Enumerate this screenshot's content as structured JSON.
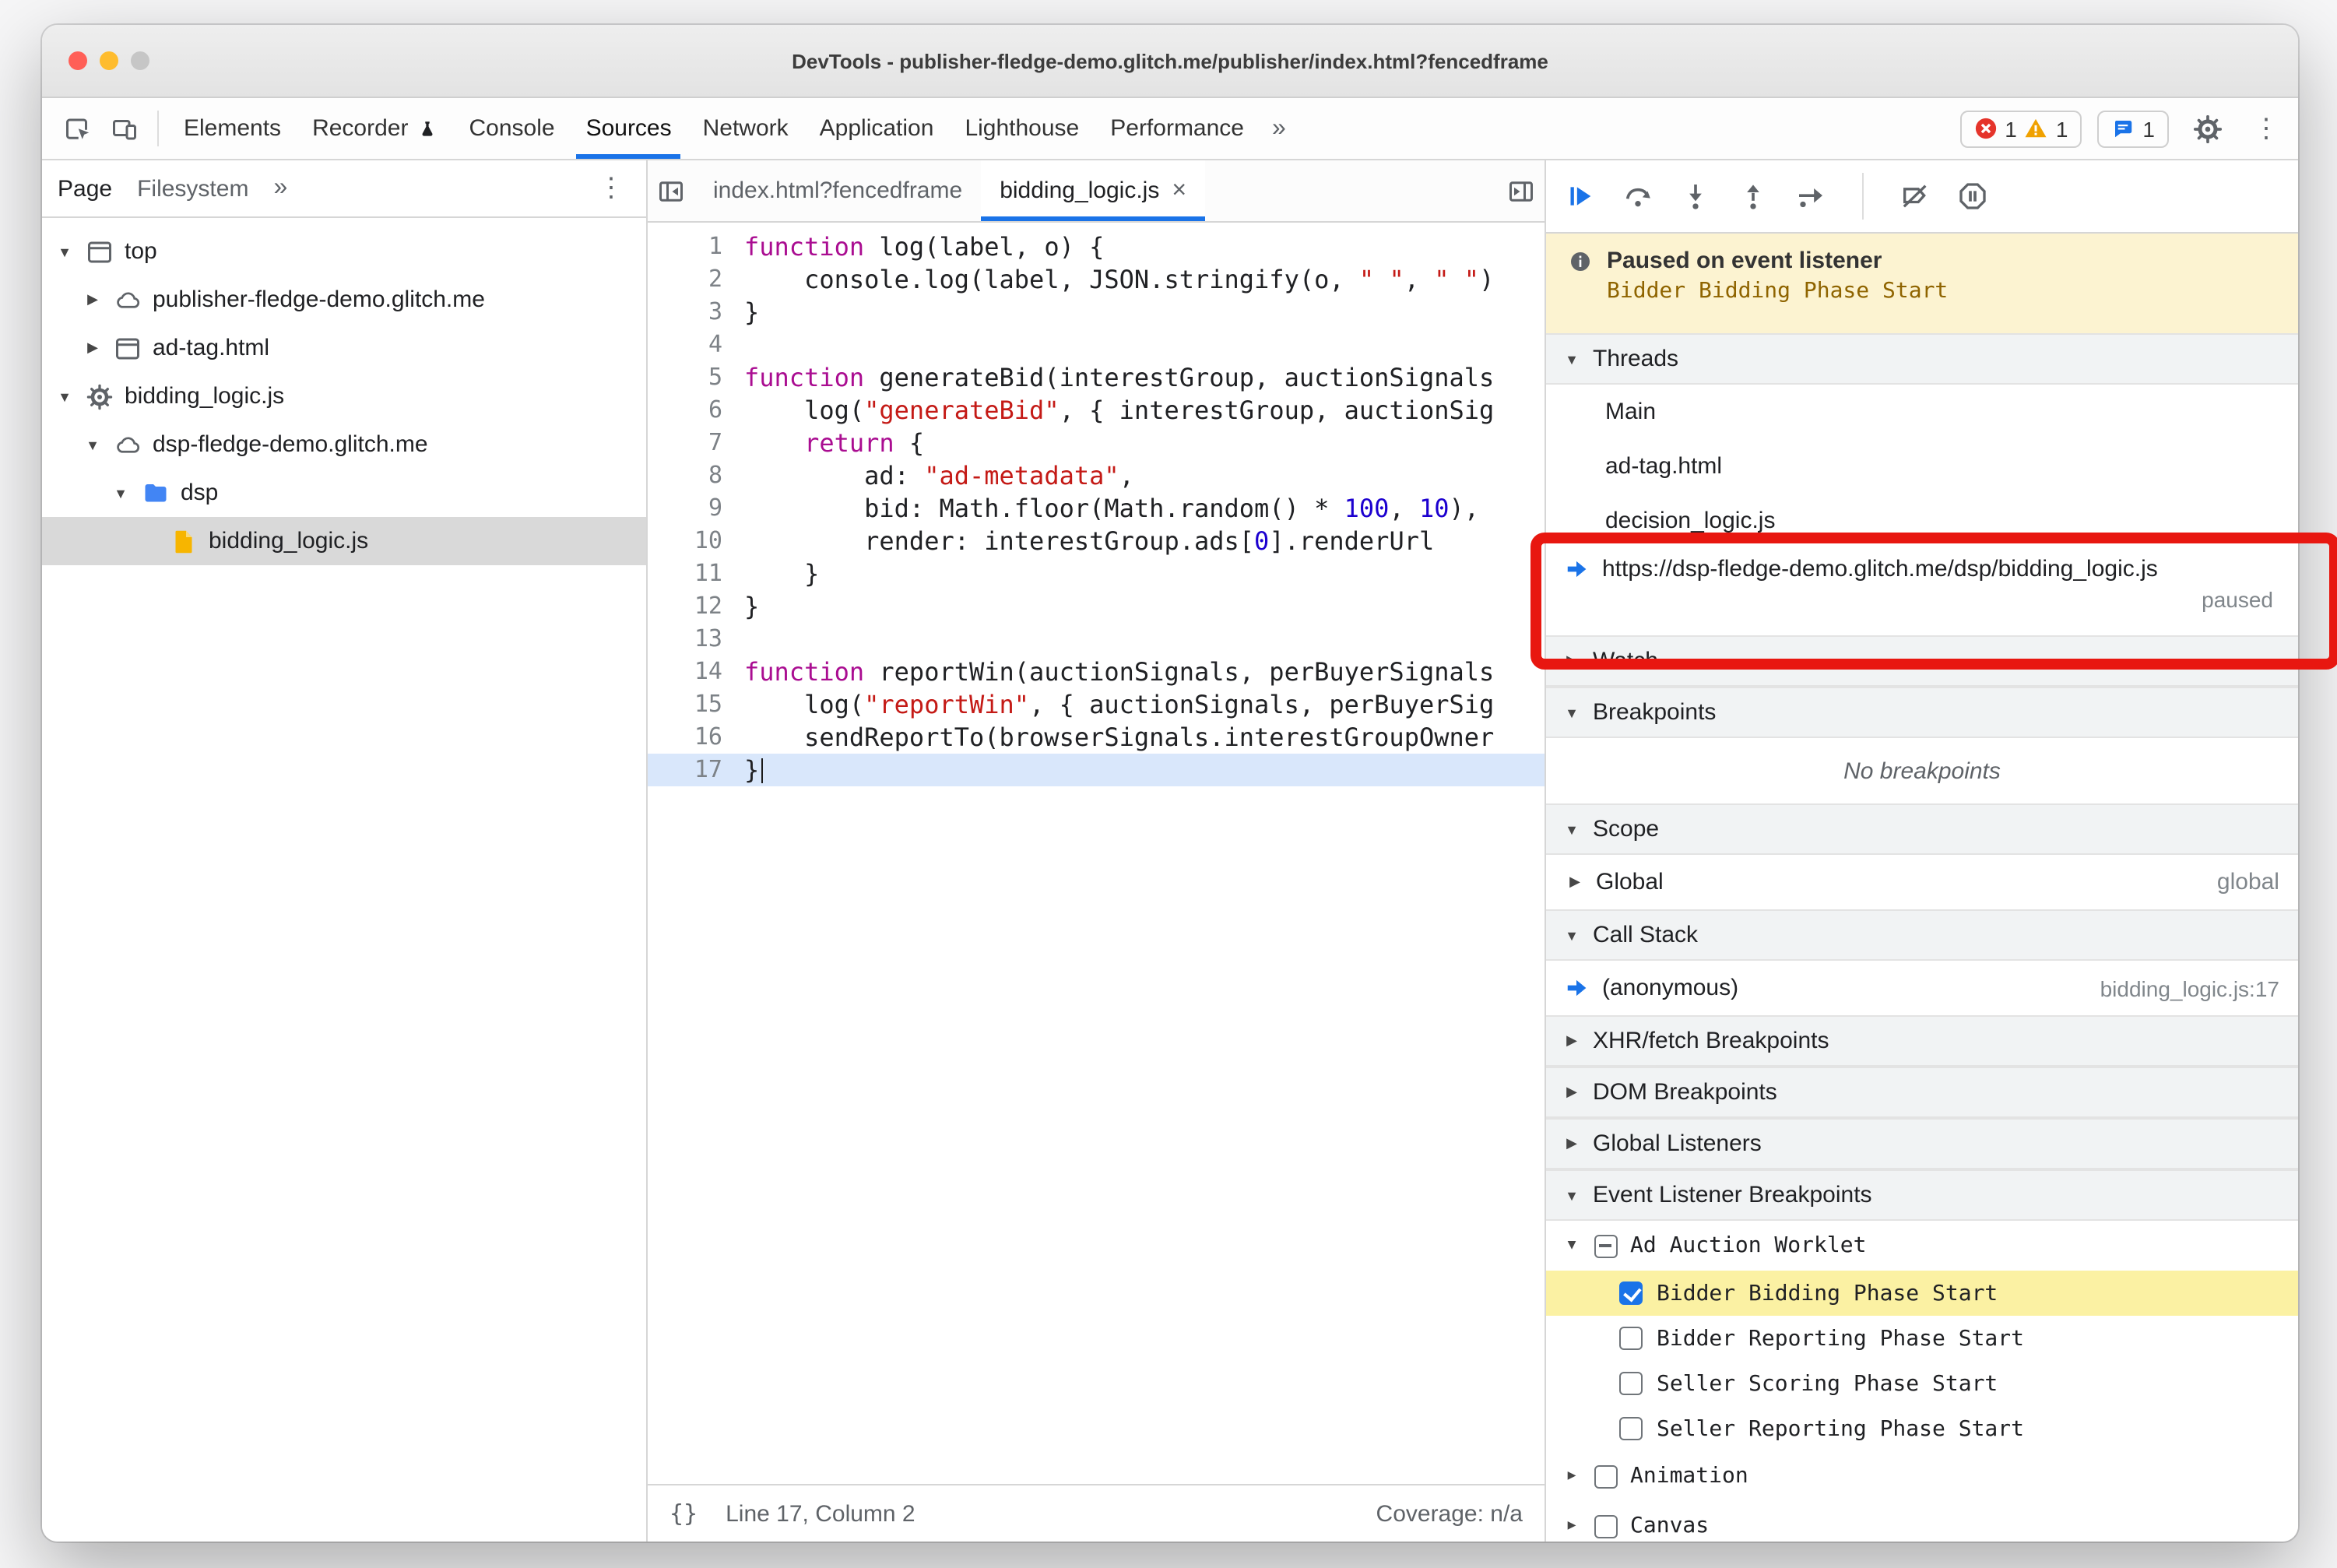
{
  "titlebar": {
    "title": "DevTools - publisher-fledge-demo.glitch.me/publisher/index.html?fencedframe"
  },
  "main_toolbar": {
    "tabs": [
      {
        "label": "Elements"
      },
      {
        "label": "Recorder",
        "badge": "flask"
      },
      {
        "label": "Console"
      },
      {
        "label": "Sources",
        "active": true
      },
      {
        "label": "Network"
      },
      {
        "label": "Application"
      },
      {
        "label": "Lighthouse"
      },
      {
        "label": "Performance"
      }
    ],
    "more": "»",
    "error_count": "1",
    "warning_count": "1",
    "issue_count": "1",
    "kebab": "⋮"
  },
  "sidebar": {
    "tabs": [
      {
        "label": "Page",
        "active": true
      },
      {
        "label": "Filesystem"
      }
    ],
    "more": "»",
    "kebab": "⋮",
    "tree": [
      {
        "label": "top",
        "icon": "frame",
        "arrow": "down",
        "indent": 0
      },
      {
        "label": "publisher-fledge-demo.glitch.me",
        "icon": "cloud",
        "arrow": "right",
        "indent": 1
      },
      {
        "label": "ad-tag.html",
        "icon": "frame",
        "arrow": "right",
        "indent": 1
      },
      {
        "label": "bidding_logic.js",
        "icon": "gear",
        "arrow": "down",
        "indent": 0
      },
      {
        "label": "dsp-fledge-demo.glitch.me",
        "icon": "cloud",
        "arrow": "down",
        "indent": 1
      },
      {
        "label": "dsp",
        "icon": "folder",
        "arrow": "down",
        "indent": 2
      },
      {
        "label": "bidding_logic.js",
        "icon": "file",
        "arrow": "none",
        "indent": 3,
        "selected": true
      }
    ]
  },
  "editor": {
    "tabs": [
      {
        "label": "index.html?fencedframe"
      },
      {
        "label": "bidding_logic.js",
        "active": true,
        "closable": true
      }
    ],
    "close_glyph": "×",
    "cursor_line": 17,
    "code": [
      [
        {
          "t": "function",
          "c": "k"
        },
        {
          "t": " log(label, o) {",
          "c": "p"
        }
      ],
      [
        {
          "t": "    console.log(label, JSON.stringify(o, ",
          "c": "p"
        },
        {
          "t": "\" \"",
          "c": "s"
        },
        {
          "t": ", ",
          "c": "p"
        },
        {
          "t": "\" \"",
          "c": "s"
        },
        {
          "t": ")",
          "c": "p"
        }
      ],
      [
        {
          "t": "}",
          "c": "p"
        }
      ],
      [],
      [
        {
          "t": "function",
          "c": "k"
        },
        {
          "t": " generateBid(interestGroup, auctionSignals",
          "c": "p"
        }
      ],
      [
        {
          "t": "    log(",
          "c": "p"
        },
        {
          "t": "\"generateBid\"",
          "c": "s"
        },
        {
          "t": ", { interestGroup, auctionSig",
          "c": "p"
        }
      ],
      [
        {
          "t": "    ",
          "c": "p"
        },
        {
          "t": "return",
          "c": "k"
        },
        {
          "t": " {",
          "c": "p"
        }
      ],
      [
        {
          "t": "        ad: ",
          "c": "p"
        },
        {
          "t": "\"ad-metadata\"",
          "c": "s"
        },
        {
          "t": ",",
          "c": "p"
        }
      ],
      [
        {
          "t": "        bid: Math.floor(Math.random() * ",
          "c": "p"
        },
        {
          "t": "100",
          "c": "n"
        },
        {
          "t": ", ",
          "c": "p"
        },
        {
          "t": "10",
          "c": "n"
        },
        {
          "t": "),",
          "c": "p"
        }
      ],
      [
        {
          "t": "        render: interestGroup.ads[",
          "c": "p"
        },
        {
          "t": "0",
          "c": "n"
        },
        {
          "t": "].renderUrl",
          "c": "p"
        }
      ],
      [
        {
          "t": "    }",
          "c": "p"
        }
      ],
      [
        {
          "t": "}",
          "c": "p"
        }
      ],
      [],
      [
        {
          "t": "function",
          "c": "k"
        },
        {
          "t": " reportWin(auctionSignals, perBuyerSignals",
          "c": "p"
        }
      ],
      [
        {
          "t": "    log(",
          "c": "p"
        },
        {
          "t": "\"reportWin\"",
          "c": "s"
        },
        {
          "t": ", { auctionSignals, perBuyerSig",
          "c": "p"
        }
      ],
      [
        {
          "t": "    sendReportTo(browserSignals.interestGroupOwner",
          "c": "p"
        }
      ],
      [
        {
          "t": "}",
          "c": "p"
        }
      ]
    ],
    "status": {
      "braces": "{}",
      "position": "Line 17, Column 2",
      "coverage": "Coverage: n/a"
    }
  },
  "debugger": {
    "paused_banner": {
      "title": "Paused on event listener",
      "detail": "Bidder Bidding Phase Start"
    },
    "threads": {
      "title": "Threads",
      "items": [
        {
          "label": "Main"
        },
        {
          "label": "ad-tag.html"
        },
        {
          "label": "decision_logic.js"
        },
        {
          "label": "https://dsp-fledge-demo.glitch.me/dsp/bidding_logic.js",
          "active": true,
          "note": "paused"
        }
      ]
    },
    "watch_title": "Watch",
    "breakpoints": {
      "title": "Breakpoints",
      "empty": "No breakpoints"
    },
    "scope": {
      "title": "Scope",
      "rows": [
        {
          "label": "Global",
          "value": "global"
        }
      ]
    },
    "call_stack": {
      "title": "Call Stack",
      "rows": [
        {
          "label": "(anonymous)",
          "value": "bidding_logic.js:17",
          "active": true
        }
      ]
    },
    "xhr_title": "XHR/fetch Breakpoints",
    "dom_title": "DOM Breakpoints",
    "global_listeners_title": "Global Listeners",
    "event_listener_breakpoints": {
      "title": "Event Listener Breakpoints",
      "groups": [
        {
          "label": "Ad Auction Worklet",
          "state": "indeterminate",
          "expanded": true,
          "items": [
            {
              "label": "Bidder Bidding Phase Start",
              "checked": true,
              "highlight": true
            },
            {
              "label": "Bidder Reporting Phase Start",
              "checked": false
            },
            {
              "label": "Seller Scoring Phase Start",
              "checked": false
            },
            {
              "label": "Seller Reporting Phase Start",
              "checked": false
            }
          ]
        },
        {
          "label": "Animation",
          "state": "unchecked",
          "expanded": false
        },
        {
          "label": "Canvas",
          "state": "unchecked",
          "expanded": false
        }
      ]
    }
  },
  "icons": {
    "inspect-icon": "cursor-in-box",
    "device-toolbar-icon": "phone-and-tablet",
    "flask-icon": "experiment-flask",
    "error-icon": "red-circle-x",
    "warning-icon": "yellow-triangle-exclamation",
    "issues-icon": "blue-speech-bubble",
    "settings-gear-icon": "gear",
    "kebab-menu-icon": "vertical-ellipsis",
    "panel-left-icon": "collapse-navigator-panel",
    "panel-right-icon": "expand-panel-right",
    "resume-icon": "bar-and-play-triangle",
    "step-over-icon": "arc-arrow-over-dot",
    "step-into-icon": "down-arrow-to-dot",
    "step-out-icon": "up-arrow-from-dot",
    "step-icon": "right-arrow-over-dot",
    "deactivate-breakpoints-icon": "slashed-breakpoint-tag",
    "pause-on-exceptions-icon": "octagon-pause",
    "info-icon": "filled-info-circle",
    "execution-arrow-icon": "blue-right-arrow",
    "frame-icon": "browser-frame",
    "cloud-icon": "cloud-outline",
    "gear-icon": "worklet-gear",
    "folder-icon": "blue-folder",
    "file-icon": "yellow-script-file",
    "disclosure-down-icon": "triangle-down",
    "disclosure-right-icon": "triangle-right"
  },
  "colors": {
    "accent_blue": "#1a73e8",
    "error_red": "#e5342b",
    "warning_yellow": "#f0a100",
    "annotation_red": "#e81710",
    "paused_banner_bg": "#fcf3d1",
    "paused_event_text": "#8f6400",
    "highlight_yellow": "#fbf1a3",
    "selected_row_gray": "#d9d9d9",
    "folder_blue": "#4285f4",
    "file_yellow": "#f7b500",
    "keyword_purple": "#aa0d91",
    "string_red": "#c41a16",
    "number_blue": "#1c00cf"
  }
}
